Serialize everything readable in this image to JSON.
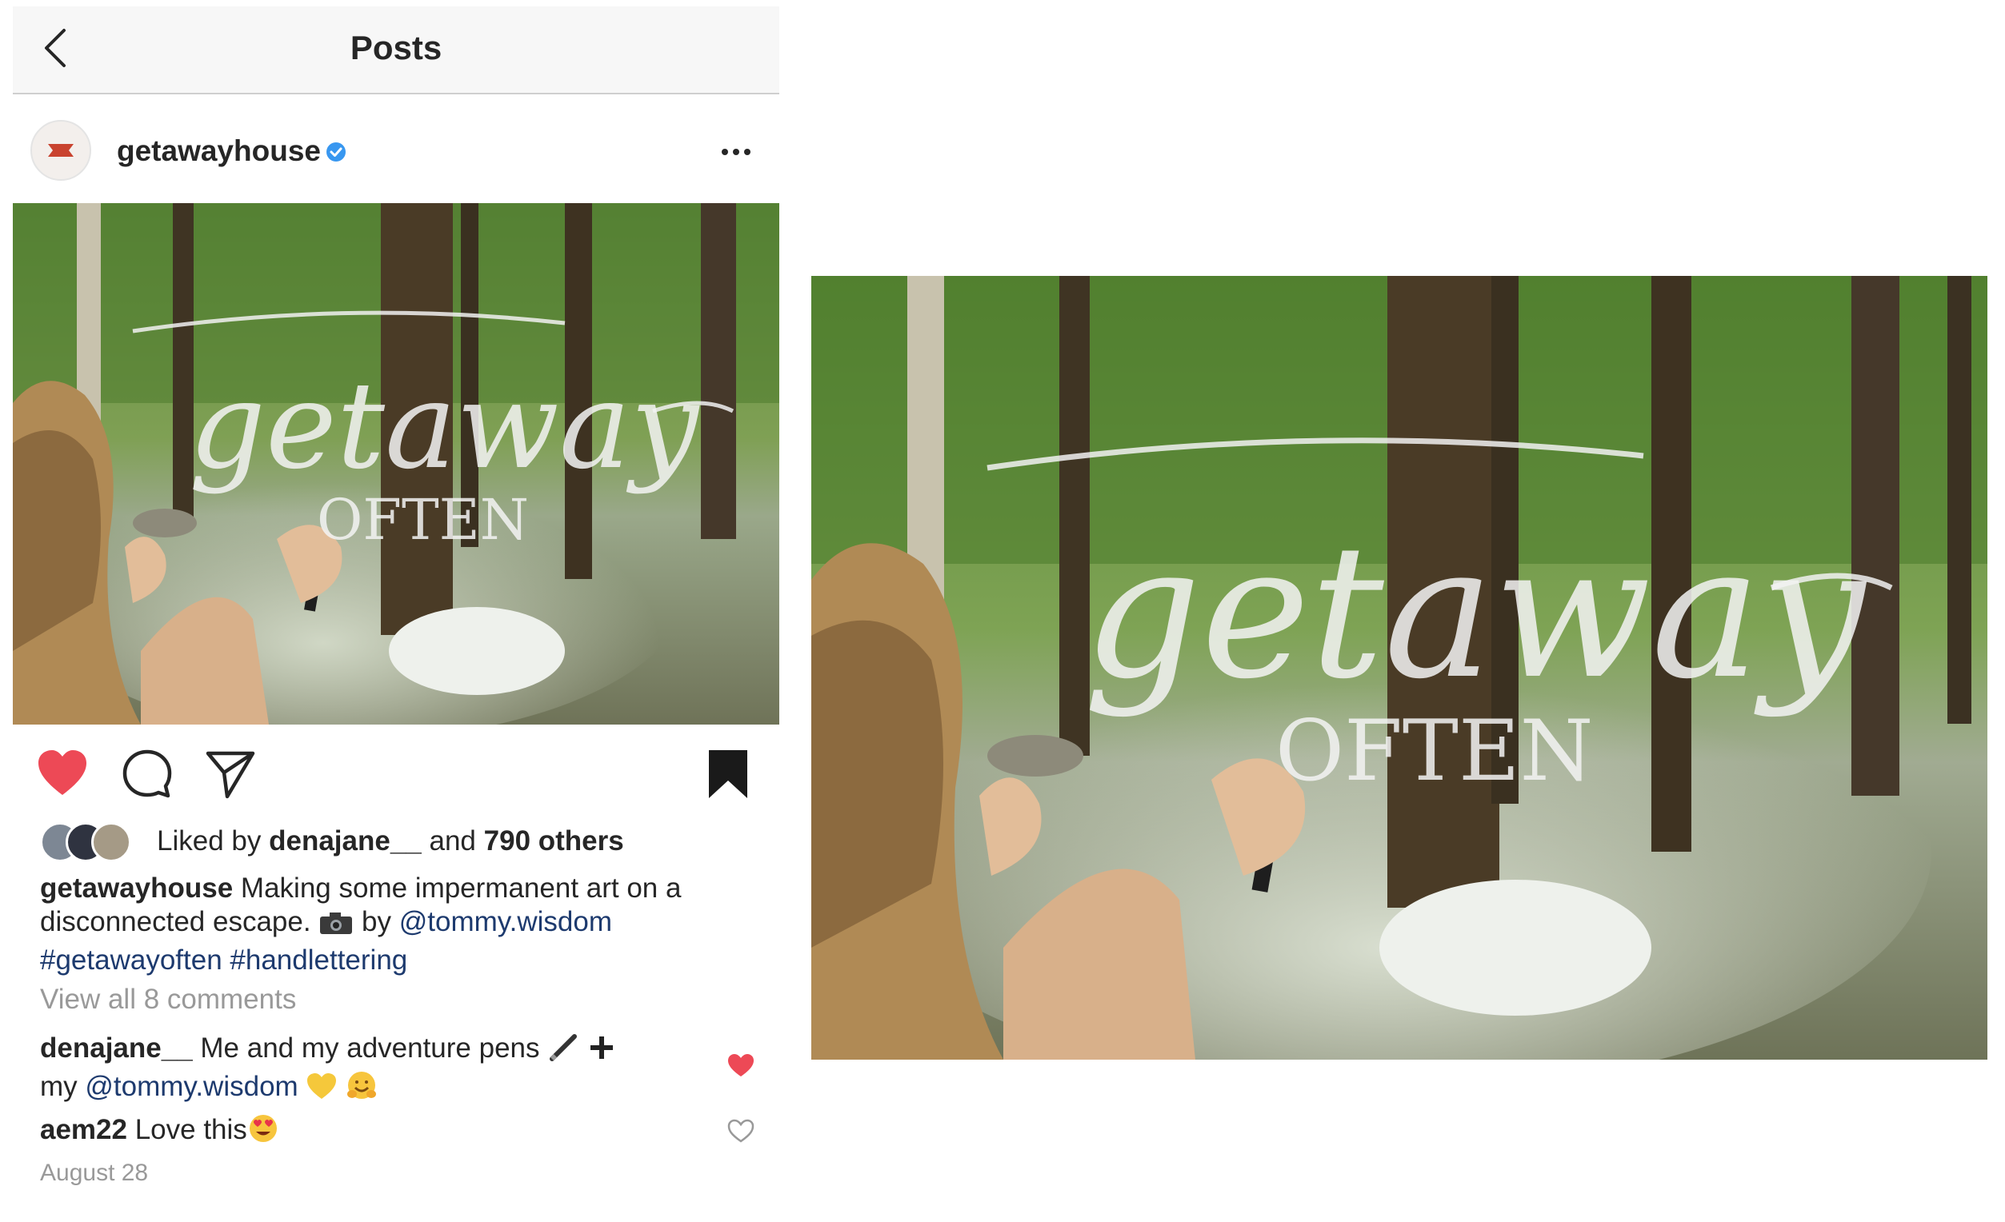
{
  "topbar": {
    "title": "Posts"
  },
  "post": {
    "username": "getawayhouse",
    "verified": true,
    "image_caption_art": {
      "word": "getaway",
      "subword": "OFTEN"
    },
    "likes": {
      "prefix": "Liked by",
      "liked_by": "denajane__",
      "and": "and",
      "others": "790 others"
    },
    "caption": {
      "username": "getawayhouse",
      "text_1": " Making some impermanent art on a disconnected escape. ",
      "text_2": " by ",
      "mention": "@tommy.wisdom",
      "hashtag_1": "#getawayoften",
      "hashtag_2": "#handlettering"
    },
    "view_comments": "View all 8 comments",
    "comments": [
      {
        "username": "denajane__",
        "text": " Me and my adventure pens ",
        "text_2": " my ",
        "mention": "@tommy.wisdom",
        "liked": true
      },
      {
        "username": "aem22",
        "text": " Love this",
        "liked": false
      }
    ],
    "date": "August 28"
  },
  "colors": {
    "heart": "#ed4956",
    "link": "#1d3a6e",
    "muted": "#999999",
    "verified": "#3897f0"
  },
  "icons": [
    "back-arrow-icon",
    "verified-badge-icon",
    "more-options-icon",
    "heart-icon",
    "comment-icon",
    "share-icon",
    "bookmark-icon"
  ]
}
